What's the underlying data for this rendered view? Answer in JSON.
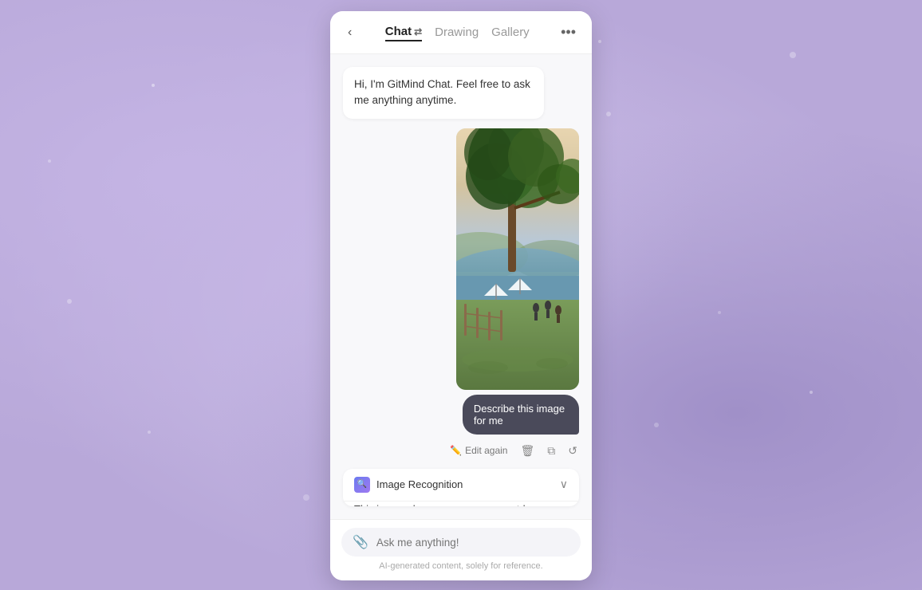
{
  "background": {
    "color": "#b8a8d9"
  },
  "close_button": {
    "label": "✕"
  },
  "expand_button": {
    "label": "▶"
  },
  "header": {
    "back_label": "‹",
    "tabs": [
      {
        "id": "chat",
        "label": "Chat",
        "active": true
      },
      {
        "id": "drawing",
        "label": "Drawing",
        "active": false
      },
      {
        "id": "gallery",
        "label": "Gallery",
        "active": false
      }
    ],
    "swap_icon": "⇄",
    "more_label": "•••"
  },
  "messages": {
    "welcome": {
      "text": "Hi, I'm GitMind Chat. Feel free to ask me anything anytime."
    },
    "user_message": {
      "text": "Describe this image for me"
    }
  },
  "bubble_actions": {
    "edit_again": "Edit again",
    "delete_icon": "🗑",
    "copy_icon": "⧉",
    "refresh_icon": "↺"
  },
  "recognition": {
    "title": "Image Recognition",
    "icon": "🔍",
    "content": "This image showcases a serene outdoor setting",
    "expanded": true,
    "chevron": "∨"
  },
  "input": {
    "placeholder": "Ask me anything!",
    "attach_icon": "📎",
    "disclaimer": "AI-generated content, solely for reference."
  }
}
